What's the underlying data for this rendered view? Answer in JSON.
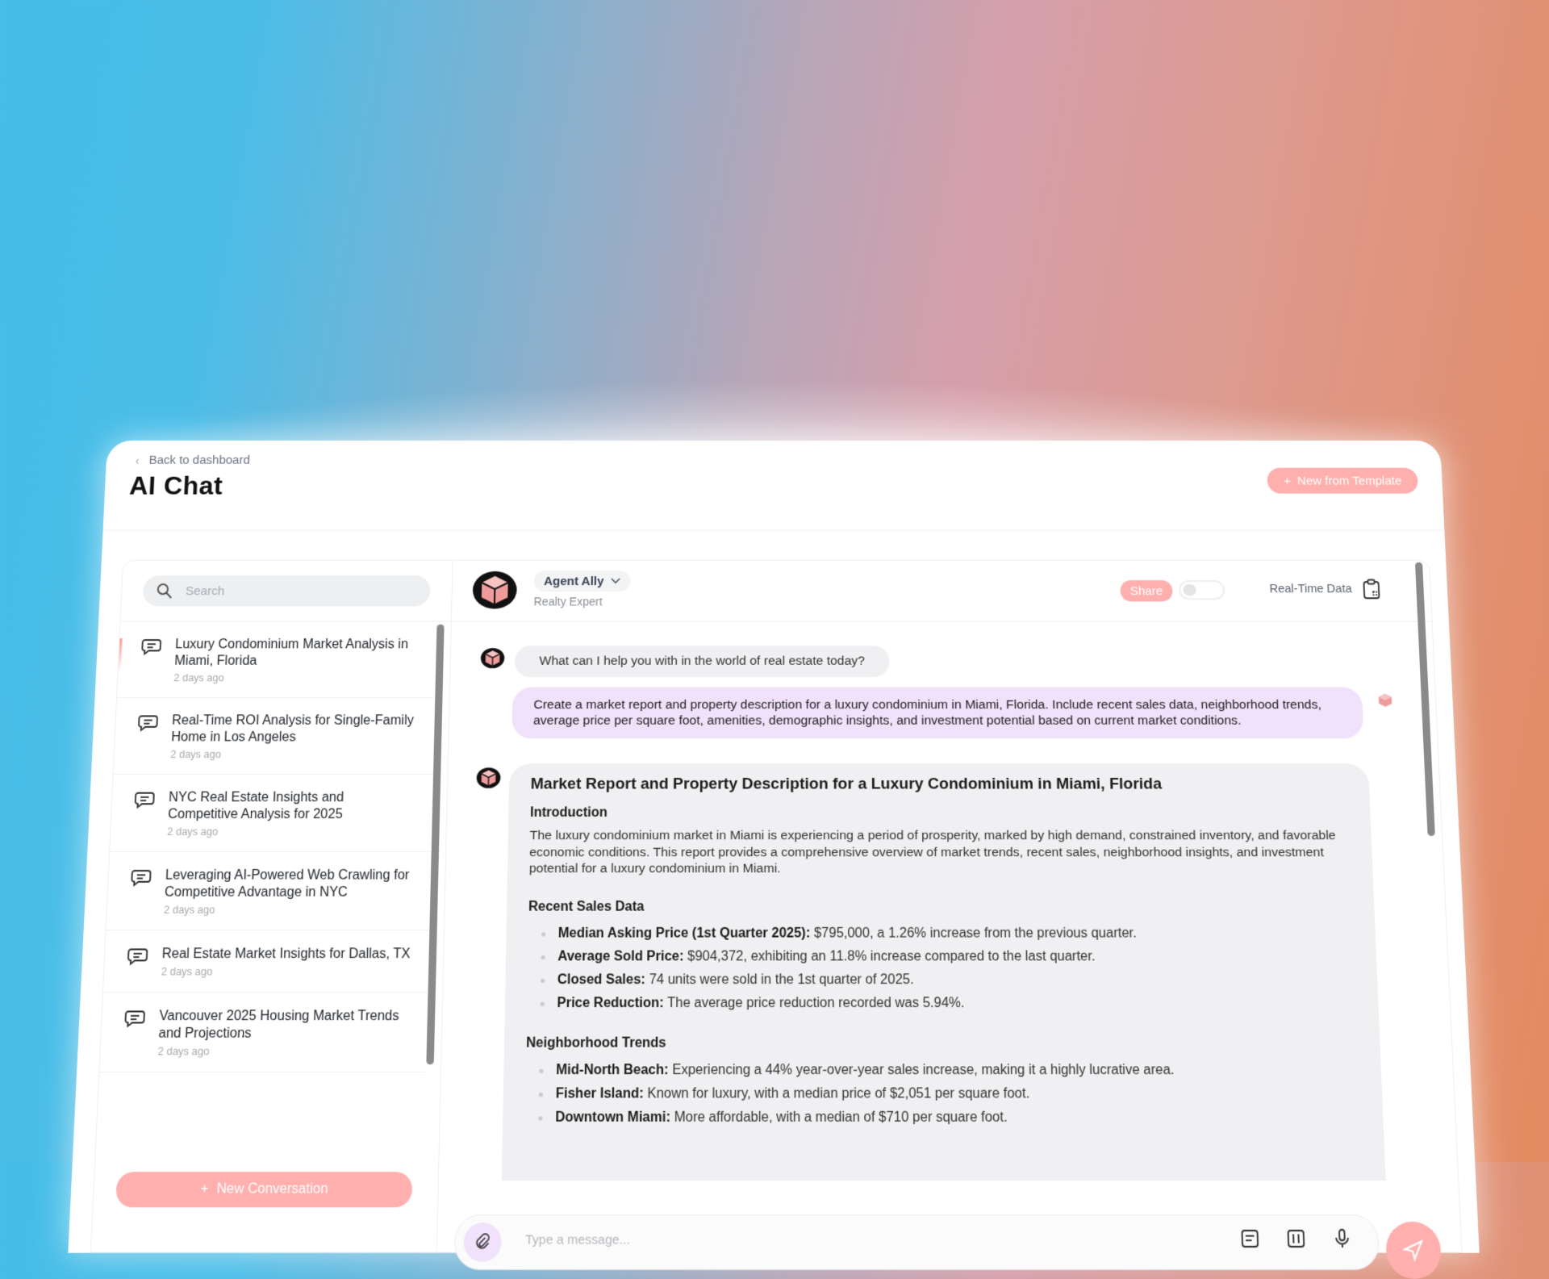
{
  "header": {
    "back_label": "Back to dashboard",
    "title": "AI Chat",
    "new_template_label": "New from Template"
  },
  "sidebar": {
    "search_placeholder": "Search",
    "conversations": [
      {
        "title": "Luxury Condominium Market Analysis in Miami, Florida",
        "time": "2 days ago",
        "active": true
      },
      {
        "title": "Real-Time ROI Analysis for Single-Family Home in Los Angeles",
        "time": "2 days ago"
      },
      {
        "title": "NYC Real Estate Insights and Competitive Analysis for 2025",
        "time": "2 days ago"
      },
      {
        "title": "Leveraging AI-Powered Web Crawling for Competitive Advantage in NYC",
        "time": "2 days ago"
      },
      {
        "title": "Real Estate Market Insights for Dallas, TX",
        "time": "2 days ago"
      },
      {
        "title": "Vancouver 2025 Housing Market Trends and Projections",
        "time": "2 days ago"
      }
    ],
    "new_conversation_label": "New Conversation"
  },
  "chat_header": {
    "agent_name": "Agent Ally",
    "agent_role": "Realty Expert",
    "share_label": "Share",
    "realtime_label": "Real-Time Data",
    "realtime_enabled": false
  },
  "messages": {
    "bot_greeting": "What can I help you with in the world of real estate today?",
    "user_prompt": "Create a market report and property description for a luxury condominium in Miami, Florida. Include recent sales data, neighborhood trends, average price per square foot, amenities, demographic insights, and investment potential based on current market conditions.",
    "report": {
      "title": "Market Report and Property Description for a Luxury Condominium in Miami, Florida",
      "intro_heading": "Introduction",
      "intro_text": "The luxury condominium market in Miami is experiencing a period of prosperity, marked by high demand, constrained inventory, and favorable economic conditions. This report provides a comprehensive overview of market trends, recent sales, neighborhood insights, and investment potential for a luxury condominium in Miami.",
      "sales_heading": "Recent Sales Data",
      "sales": [
        {
          "label": "Median Asking Price (1st Quarter 2025):",
          "text": " $795,000, a 1.26% increase from the previous quarter."
        },
        {
          "label": "Average Sold Price:",
          "text": " $904,372, exhibiting an 11.8% increase compared to the last quarter."
        },
        {
          "label": "Closed Sales:",
          "text": " 74 units were sold in the 1st quarter of 2025."
        },
        {
          "label": "Price Reduction:",
          "text": " The average price reduction recorded was 5.94%."
        }
      ],
      "trends_heading": "Neighborhood Trends",
      "trends": [
        {
          "label": "Mid-North Beach:",
          "text": " Experiencing a 44% year-over-year sales increase, making it a highly lucrative area."
        },
        {
          "label": "Fisher Island:",
          "text": " Known for luxury, with a median price of $2,051 per square foot."
        },
        {
          "label": "Downtown Miami:",
          "text": " More affordable, with a median of $710 per square foot."
        }
      ]
    }
  },
  "composer": {
    "placeholder": "Type a message..."
  },
  "colors": {
    "accent": "#ffb0ae",
    "user_bubble": "#f1e1fb",
    "bot_bubble": "#f0f0f2"
  }
}
